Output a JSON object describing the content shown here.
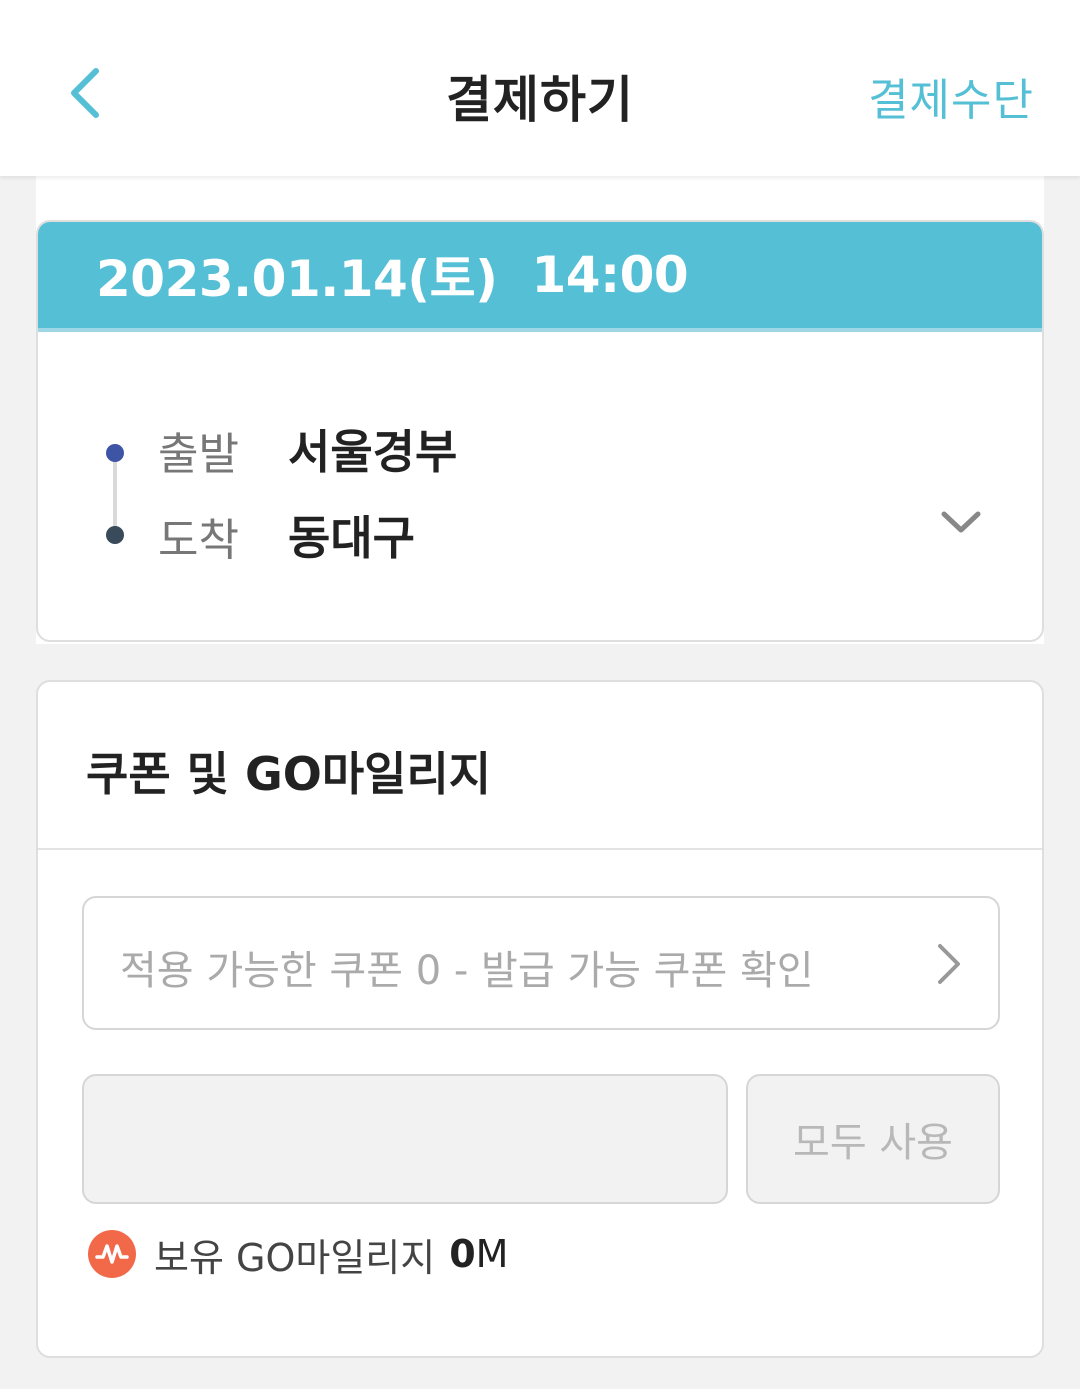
{
  "header": {
    "title": "결제하기",
    "right_action": "결제수단",
    "accent_color": "#55bfd6"
  },
  "trip": {
    "date": "2023.01.14(토)",
    "time": "14:00",
    "departure_label": "출발",
    "departure": "서울경부",
    "arrival_label": "도착",
    "arrival": "동대구",
    "departure_dot_color": "#3e55a6",
    "arrival_dot_color": "#394a5a"
  },
  "coupon_section": {
    "title": "쿠폰 및 GO마일리지",
    "coupon_placeholder": "적용 가능한 쿠폰 0 - 발급 가능 쿠폰 확인",
    "mileage_input_value": "",
    "use_all_label": "모두 사용",
    "owned_mileage_label": "보유 GO마일리지",
    "owned_mileage_amount": "0",
    "owned_mileage_unit": "M",
    "mileage_icon_color": "#f2694a"
  },
  "icons": {
    "back": "chevron-left-icon",
    "expand": "chevron-down-icon",
    "coupon_arrow": "chevron-right-icon",
    "mileage": "mileage-m-icon"
  }
}
